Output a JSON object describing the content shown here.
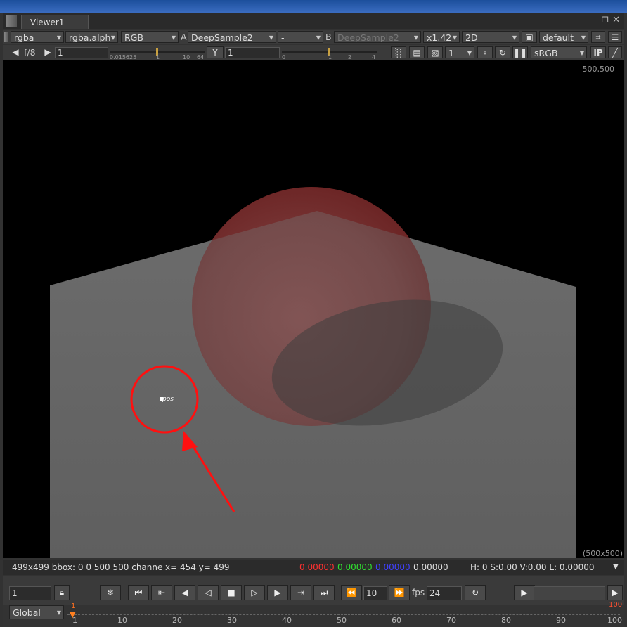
{
  "window": {
    "tab_title": "Viewer1"
  },
  "toolbar1": {
    "channels": "rgba",
    "alpha_channel": "rgba.alph",
    "display_channels": "RGB",
    "a_label": "A",
    "a_input": "DeepSample2",
    "operation": "-",
    "b_label": "B",
    "b_input": "DeepSample2",
    "zoom": "x1.42",
    "view_mode": "2D",
    "lut_default": "default"
  },
  "toolbar2": {
    "fstop": "f/8",
    "gain_value": "1",
    "gain_ticks": [
      "0.015625",
      "1",
      "10",
      "64"
    ],
    "gamma_label": "Y",
    "gamma_value": "1",
    "gamma_ticks": [
      "0",
      "1",
      "2",
      "4"
    ],
    "proxy_value": "1",
    "colorspace": "sRGB",
    "ip_label": "IP"
  },
  "viewer": {
    "top_right_coord": "500,500",
    "bottom_right_size": "(500x500)",
    "annotation_text": "pos"
  },
  "status": {
    "info": "499x499 bbox: 0 0 500 500 channe",
    "coords": "x= 454 y= 499",
    "r": "0.00000",
    "g": "0.00000",
    "b": "0.00000",
    "a": "0.00000",
    "hsvl": "H:  0 S:0.00 V:0.00  L: 0.00000",
    "colors": {
      "r": "#ff3030",
      "g": "#30e030",
      "b": "#4040ff"
    }
  },
  "playback": {
    "frame": "1",
    "step": "10",
    "fps_label": "fps",
    "fps_value": "24"
  },
  "timeline": {
    "scope": "Global",
    "start": "1",
    "end": "100",
    "ticks": [
      "1",
      "10",
      "20",
      "30",
      "40",
      "50",
      "60",
      "70",
      "80",
      "90",
      "100"
    ]
  }
}
